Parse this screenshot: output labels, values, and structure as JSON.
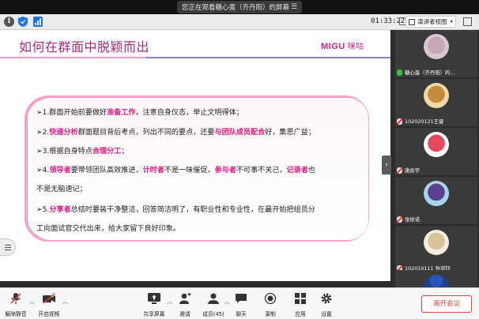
{
  "top_bar": {
    "share_text": "您正在观看糖心蛋（齐丹阳）的屏幕"
  },
  "info_bar": {
    "timer": "01:33:22",
    "view_button": "演讲者视图"
  },
  "slide": {
    "title": "如何在群面中脱颖而出",
    "logo_text": "MIGU",
    "logo_zh": "咪咕",
    "items": [
      {
        "segments": [
          {
            "t": "➢",
            "hl": false
          },
          {
            "t": "1.群面开始前要做好",
            "hl": false
          },
          {
            "t": "准备工作",
            "hl": true
          },
          {
            "t": "，注意自身仪态，举止文明得体；",
            "hl": false
          }
        ]
      },
      {
        "segments": [
          {
            "t": "➢",
            "hl": false
          },
          {
            "t": "2.",
            "hl": false
          },
          {
            "t": "快速分析",
            "hl": true
          },
          {
            "t": "群面题目背后考点，列出不同的要点，还要",
            "hl": false
          },
          {
            "t": "与团队成员配合",
            "hl": true
          },
          {
            "t": "好，集思广益；",
            "hl": false
          }
        ]
      },
      {
        "segments": [
          {
            "t": "➢",
            "hl": false
          },
          {
            "t": "3.根据自身特点",
            "hl": false
          },
          {
            "t": "合理分工",
            "hl": true
          },
          {
            "t": "；",
            "hl": false
          }
        ]
      },
      {
        "segments": [
          {
            "t": "➢",
            "hl": false
          },
          {
            "t": "4.",
            "hl": false
          },
          {
            "t": "领导者",
            "hl": true
          },
          {
            "t": "要带领团队高效推进，",
            "hl": false
          },
          {
            "t": "计时者",
            "hl": true
          },
          {
            "t": "不是一味催促，",
            "hl": false
          },
          {
            "t": "参与者",
            "hl": true
          },
          {
            "t": "不可事不关己，",
            "hl": false
          },
          {
            "t": "记录者",
            "hl": true
          },
          {
            "t": "也",
            "hl": false
          }
        ]
      },
      {
        "segments": [
          {
            "t": "不是无脑速记；",
            "hl": false
          }
        ]
      },
      {
        "segments": [
          {
            "t": "➢",
            "hl": false
          },
          {
            "t": "5.",
            "hl": false
          },
          {
            "t": "分享者",
            "hl": true
          },
          {
            "t": "总结时要装干净整洁，回答简洁明了，有职业性和专业性，在最开始把组员分",
            "hl": false
          }
        ]
      },
      {
        "segments": [
          {
            "t": "工向面试官交代出来，给大家留下良好印象。",
            "hl": false
          }
        ]
      }
    ]
  },
  "participants": [
    {
      "name": "糖心蛋（齐丹阳）的...",
      "mic": "on",
      "avatar_color": "#c8a6b8",
      "avatar_bg": "#d9c7d3"
    },
    {
      "name": "102020121王睿",
      "mic": "off",
      "avatar_color": "#c88a3c",
      "avatar_bg": "#f1d8a8"
    },
    {
      "name": "唐俞宇",
      "mic": "off",
      "avatar_color": "#e54a5d",
      "avatar_bg": "#ffffff"
    },
    {
      "name": "张依诺",
      "mic": "off",
      "avatar_color": "#5c3f8e",
      "avatar_bg": "#a9d4ee"
    },
    {
      "name": "102010111 张润钰",
      "mic": "off",
      "avatar_color": "#d9c49a",
      "avatar_bg": "#f4efe2"
    },
    {
      "name": "",
      "mic": "off",
      "avatar_color": "#2a55b8",
      "avatar_bg": "#1f3f8a"
    }
  ],
  "controls": {
    "mute": "解除静音",
    "video": "开启视频",
    "share": "共享屏幕",
    "invite": "邀请",
    "members": "成员(45)",
    "chat": "聊天",
    "record": "录制",
    "apps": "应用",
    "settings": "设置",
    "leave": "离开会议"
  },
  "colors": {
    "accent_pink": "#e01c85",
    "title_purple": "#a4297d",
    "leave_red": "#e23c3c"
  }
}
